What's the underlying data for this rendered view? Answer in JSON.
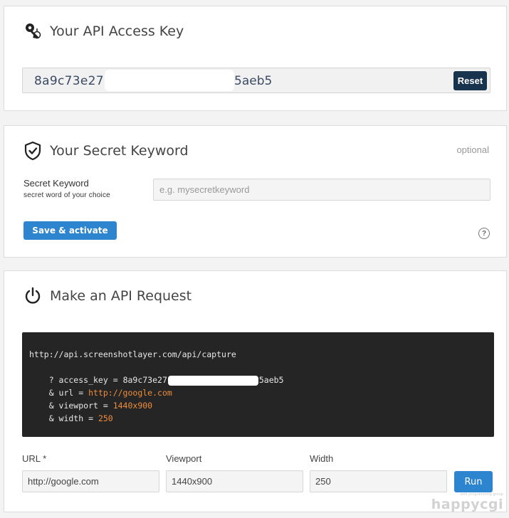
{
  "api_key_panel": {
    "title": "Your API Access Key",
    "icon": "key-icon",
    "key_visible_start": "8a9c73e27",
    "key_visible_end": "5aeb5",
    "reset_label": "Reset"
  },
  "secret_panel": {
    "title": "Your Secret Keyword",
    "icon": "shield-check-icon",
    "optional_label": "optional",
    "field_label": "Secret Keyword",
    "field_sublabel": "secret word of your choice",
    "input_placeholder": "e.g. mysecretkeyword",
    "input_value": "",
    "save_label": "Save & activate",
    "help_label": "?"
  },
  "request_panel": {
    "title": "Make an API Request",
    "icon": "power-icon",
    "code": {
      "endpoint": "http://api.screenshotlayer.com/api/capture",
      "access_key_prefix": "    ? access_key = ",
      "access_key_start": "8a9c73e27",
      "access_key_end": "5aeb5",
      "url_prefix": "    & url = ",
      "url_value": "http://google.com",
      "viewport_prefix": "    & viewport = ",
      "viewport_value": "1440x900",
      "width_prefix": "    & width = ",
      "width_value": "250"
    },
    "url_label": "URL *",
    "url_value": "http://google.com",
    "viewport_label": "Viewport",
    "viewport_value": "1440x900",
    "width_label": "Width",
    "width_value": "250",
    "run_label": "Run"
  },
  "watermark": {
    "sub": "web programming group",
    "main": "happycgi"
  },
  "colors": {
    "accent_blue": "#2d84cf",
    "reset_navy": "#17334d",
    "code_bg": "#252525",
    "code_value_orange": "#f08d3c"
  }
}
